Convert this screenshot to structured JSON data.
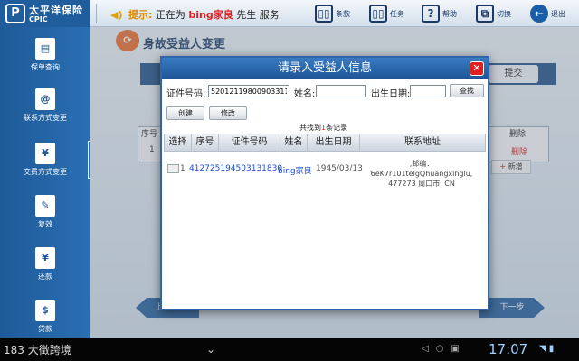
{
  "topbar": {
    "logo_cn": "太平洋保险",
    "logo_en": "CPIC",
    "notice_label": "提示:",
    "notice_pre": "正在为",
    "notice_name": "bing家良",
    "notice_post": "先生 服务",
    "items": [
      {
        "label": "条款",
        "icon": "book-icon"
      },
      {
        "label": "任务",
        "icon": "book-icon"
      },
      {
        "label": "帮助",
        "icon": "help-icon"
      },
      {
        "label": "切换",
        "icon": "switch-icon"
      },
      {
        "label": "退出",
        "icon": "exit-icon"
      }
    ]
  },
  "sidebar": {
    "items": [
      {
        "label": "保单查询",
        "icon": "document-search-icon"
      },
      {
        "label": "联系方式变更",
        "icon": "contact-change-icon"
      },
      {
        "label": "交费方式变更",
        "icon": "payment-change-icon"
      },
      {
        "label": "复效",
        "icon": "reinstate-icon"
      },
      {
        "label": "还款",
        "icon": "repay-icon"
      },
      {
        "label": "贷款",
        "icon": "loan-icon"
      }
    ]
  },
  "page": {
    "title": "身故受益人变更",
    "tab_right": "提交",
    "bg_headers": [
      "序号",
      "删除"
    ],
    "bg_row_no": "1",
    "bg_row_delete": "删除",
    "bg_add": "新增",
    "nav_prev": "上一步",
    "nav_next": "下一步"
  },
  "modal": {
    "title": "请录入受益人信息",
    "id_label": "证件号码:",
    "id_value": "52012119800903311",
    "name_label": "姓名:",
    "name_value": "",
    "dob_label": "出生日期:",
    "dob_value": "",
    "search_btn": "查找",
    "create_btn": "创建",
    "edit_btn": "修改",
    "found_pre": "共找到",
    "found_count": "1",
    "found_post": "条记录",
    "columns": [
      "选择",
      "序号",
      "证件号码",
      "姓名",
      "出生日期",
      "联系地址"
    ],
    "rows": [
      {
        "no": "1",
        "id": "412725194503131830",
        "name": "bing家良",
        "dob": "1945/03/13",
        "addr1": ",邮编：",
        "addr2": "6eK7r101telgQhuangxinglu,",
        "addr3": "477273 周口市, CN"
      }
    ]
  },
  "android": {
    "logo": "183 大徵跨境",
    "time": "17:07"
  }
}
